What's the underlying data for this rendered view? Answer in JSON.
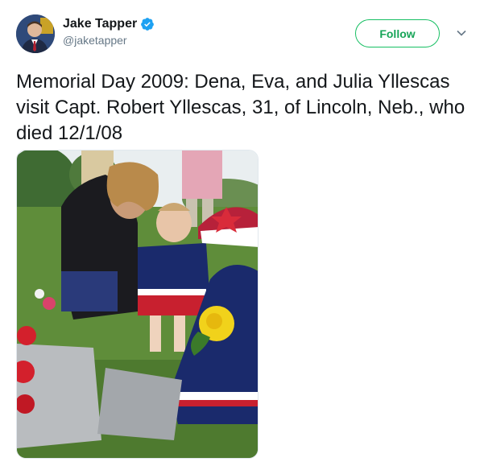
{
  "author": {
    "display_name": "Jake Tapper",
    "handle": "@jaketapper",
    "verified": true
  },
  "actions": {
    "follow_label": "Follow"
  },
  "tweet": {
    "text": "Memorial Day 2009: Dena, Eva, and Julia Yllescas visit Capt. Robert Yllescas, 31, of Lincoln, Neb., who died 12/1/08"
  },
  "colors": {
    "follow_green": "#17bf63",
    "verified_blue": "#1da1f2",
    "handle_gray": "#657786"
  },
  "icons": {
    "verified": "verified-badge-icon",
    "more": "chevron-down-icon"
  }
}
